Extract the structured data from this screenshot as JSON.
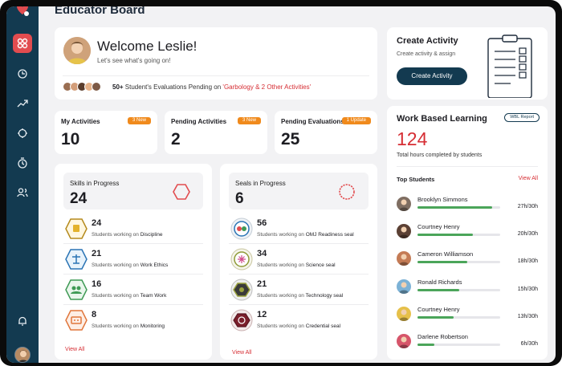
{
  "page": {
    "title": "Educator Board"
  },
  "welcome": {
    "title": "Welcome Leslie!",
    "subtitle": "Let's see what's going on!",
    "pending_count": "50+",
    "pending_text": " Student's Evaluations Pending on ",
    "pending_activities": "'Garbology & 2 Other Activities'"
  },
  "stats": [
    {
      "label": "My Activities",
      "badge": "3 New",
      "value": "10"
    },
    {
      "label": "Pending Activities",
      "badge": "3 New",
      "value": "2"
    },
    {
      "label": "Pending Evaluations",
      "badge": "1 Update",
      "value": "25"
    }
  ],
  "skills": {
    "label": "Skills in Progress",
    "value": "24",
    "working_text": "Students working on ",
    "view_all": "View All",
    "items": [
      {
        "count": "24",
        "name": "Discipline",
        "icon": "discipline-icon"
      },
      {
        "count": "21",
        "name": "Work Ethics",
        "icon": "work-ethics-icon"
      },
      {
        "count": "16",
        "name": "Team Work",
        "icon": "team-work-icon"
      },
      {
        "count": "8",
        "name": "Monitoring",
        "icon": "monitoring-icon"
      }
    ]
  },
  "seals": {
    "label": "Seals in Progress",
    "value": "6",
    "working_text": "Students working on ",
    "view_all": "View All",
    "items": [
      {
        "count": "56",
        "name": "OMJ Readiness seal",
        "icon": "omj-readiness-seal-icon"
      },
      {
        "count": "34",
        "name": "Science seal",
        "icon": "science-seal-icon"
      },
      {
        "count": "21",
        "name": "Technology seal",
        "icon": "technology-seal-icon"
      },
      {
        "count": "12",
        "name": "Credential seal",
        "icon": "credential-seal-icon"
      }
    ]
  },
  "create_activity": {
    "title": "Create Activity",
    "subtitle": "Create activity & assign",
    "button": "Create Activity"
  },
  "wbl": {
    "title": "Work Based Learning",
    "report_button": "WBL Report",
    "total": "124",
    "subtitle": "Total hours completed by students",
    "top_label": "Top Students",
    "view_all": "View All",
    "students": [
      {
        "name": "Brooklyn Simmons",
        "hours": "27h/30h",
        "progress": 0.9,
        "color": "#7f6e62"
      },
      {
        "name": "Courtney Henry",
        "hours": "20h/30h",
        "progress": 0.667,
        "color": "#5b4034"
      },
      {
        "name": "Cameron Williamson",
        "hours": "18h/30h",
        "progress": 0.6,
        "color": "#c47b55"
      },
      {
        "name": "Ronald Richards",
        "hours": "15h/30h",
        "progress": 0.5,
        "color": "#7cb2d6"
      },
      {
        "name": "Courtney Henry",
        "hours": "13h/30h",
        "progress": 0.433,
        "color": "#e6c04a"
      },
      {
        "name": "Darlene Robertson",
        "hours": "6h/30h",
        "progress": 0.2,
        "color": "#d6556a"
      }
    ]
  },
  "colors": {
    "brand_navy": "#133a50",
    "accent_red": "#d62e34",
    "badge_orange": "#f08a1c",
    "progress_green": "#4ba55a"
  }
}
